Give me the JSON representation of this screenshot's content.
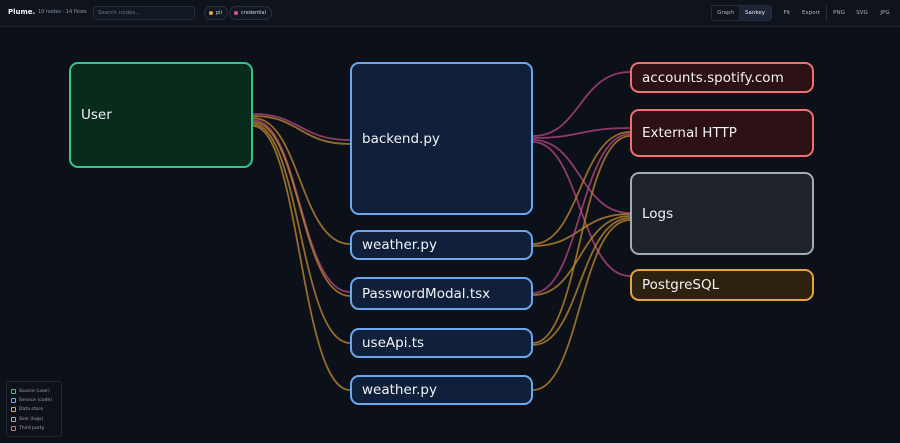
{
  "app": {
    "brand": "Plume.",
    "stats": "10 nodes · 14 flows",
    "search_placeholder": "Search nodes..."
  },
  "filters": [
    {
      "label": "pii",
      "color": "#e7a33e"
    },
    {
      "label": "credential",
      "color": "#e0528f"
    }
  ],
  "view_toggle": {
    "graph": "Graph",
    "sankey": "Sankey",
    "active": "sankey"
  },
  "toolbar": {
    "fit": "Fit",
    "export": "Export",
    "png": "PNG",
    "svg": "SVG",
    "jpg": "JPG"
  },
  "nodes": {
    "user": "User",
    "backend": "backend.py",
    "weather1": "weather.py",
    "password_modal": "PasswordModal.tsx",
    "use_api": "useApi.ts",
    "weather2": "weather.py",
    "spotify": "accounts.spotify.com",
    "external_http": "External HTTP",
    "logs": "Logs",
    "postgres": "PostgreSQL"
  },
  "legend": [
    {
      "label": "Source (user)",
      "color": "#36c48a"
    },
    {
      "label": "Service (code)",
      "color": "#6ba8ef"
    },
    {
      "label": "Data store",
      "color": "#e7a33e"
    },
    {
      "label": "Sink (logs)",
      "color": "#a3abb6"
    },
    {
      "label": "Third party",
      "color": "#ec7272"
    }
  ],
  "colors": {
    "edge_pii": "#b9832f",
    "edge_credential": "#b0457e"
  }
}
